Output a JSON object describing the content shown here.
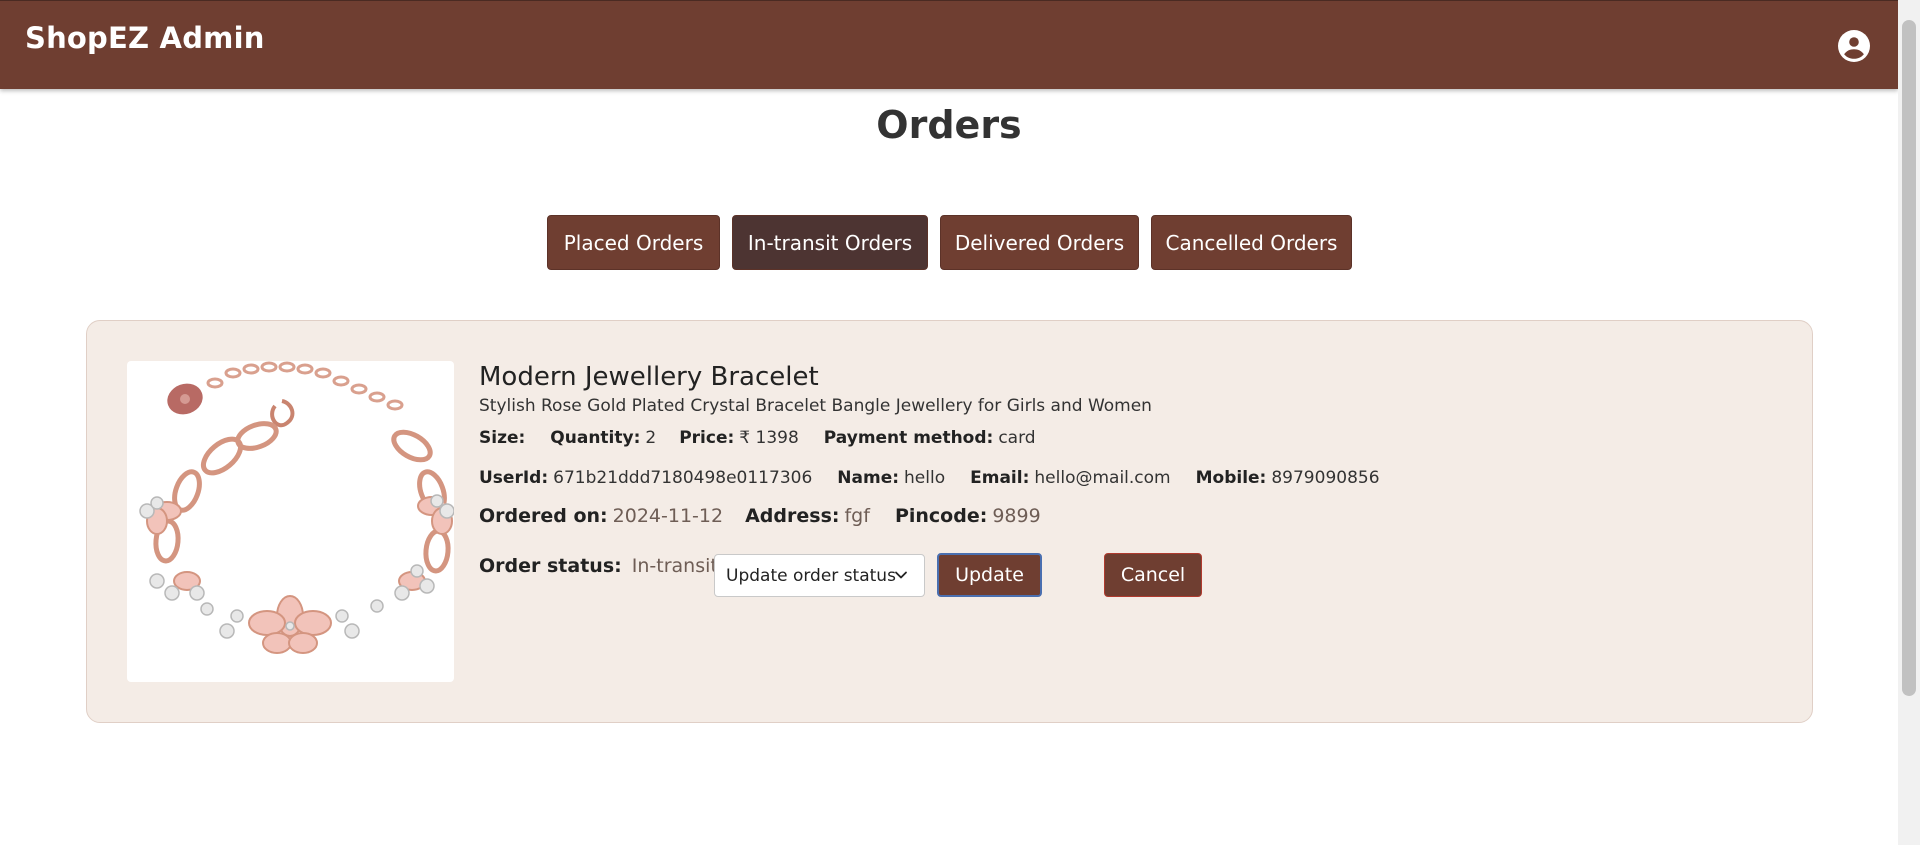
{
  "app": {
    "brand": "ShopEZ Admin",
    "colors": {
      "navbar": "#6f3e31",
      "tab_active": "#4d3432",
      "card_bg": "#f4ece6",
      "accent_focus": "#4a6fb0"
    }
  },
  "header": {
    "account_icon": "account-circle-icon"
  },
  "page": {
    "title": "Orders"
  },
  "tabs": [
    {
      "label": "Placed Orders",
      "active": false
    },
    {
      "label": "In-transit Orders",
      "active": true
    },
    {
      "label": "Delivered Orders",
      "active": false
    },
    {
      "label": "Cancelled Orders",
      "active": false
    }
  ],
  "order": {
    "product_name": "Modern Jewellery Bracelet",
    "description": "Stylish Rose Gold Plated Crystal Bracelet Bangle Jewellery for Girls and Women",
    "size_label": "Size:",
    "size": "",
    "quantity_label": "Quantity:",
    "quantity": "2",
    "price_label": "Price:",
    "price": "₹ 1398",
    "payment_label": "Payment method:",
    "payment": "card",
    "userid_label": "UserId:",
    "userid": "671b21ddd7180498e0117306",
    "name_label": "Name:",
    "name": "hello",
    "email_label": "Email:",
    "email": "hello@mail.com",
    "mobile_label": "Mobile:",
    "mobile": "8979090856",
    "ordered_label": "Ordered on:",
    "ordered_on": "2024-11-12",
    "address_label": "Address:",
    "address": "fgf",
    "pincode_label": "Pincode:",
    "pincode": "9899",
    "status_label": "Order status:",
    "status": "In-transit"
  },
  "actions": {
    "select_placeholder": "Update order status",
    "update_label": "Update",
    "cancel_label": "Cancel"
  }
}
